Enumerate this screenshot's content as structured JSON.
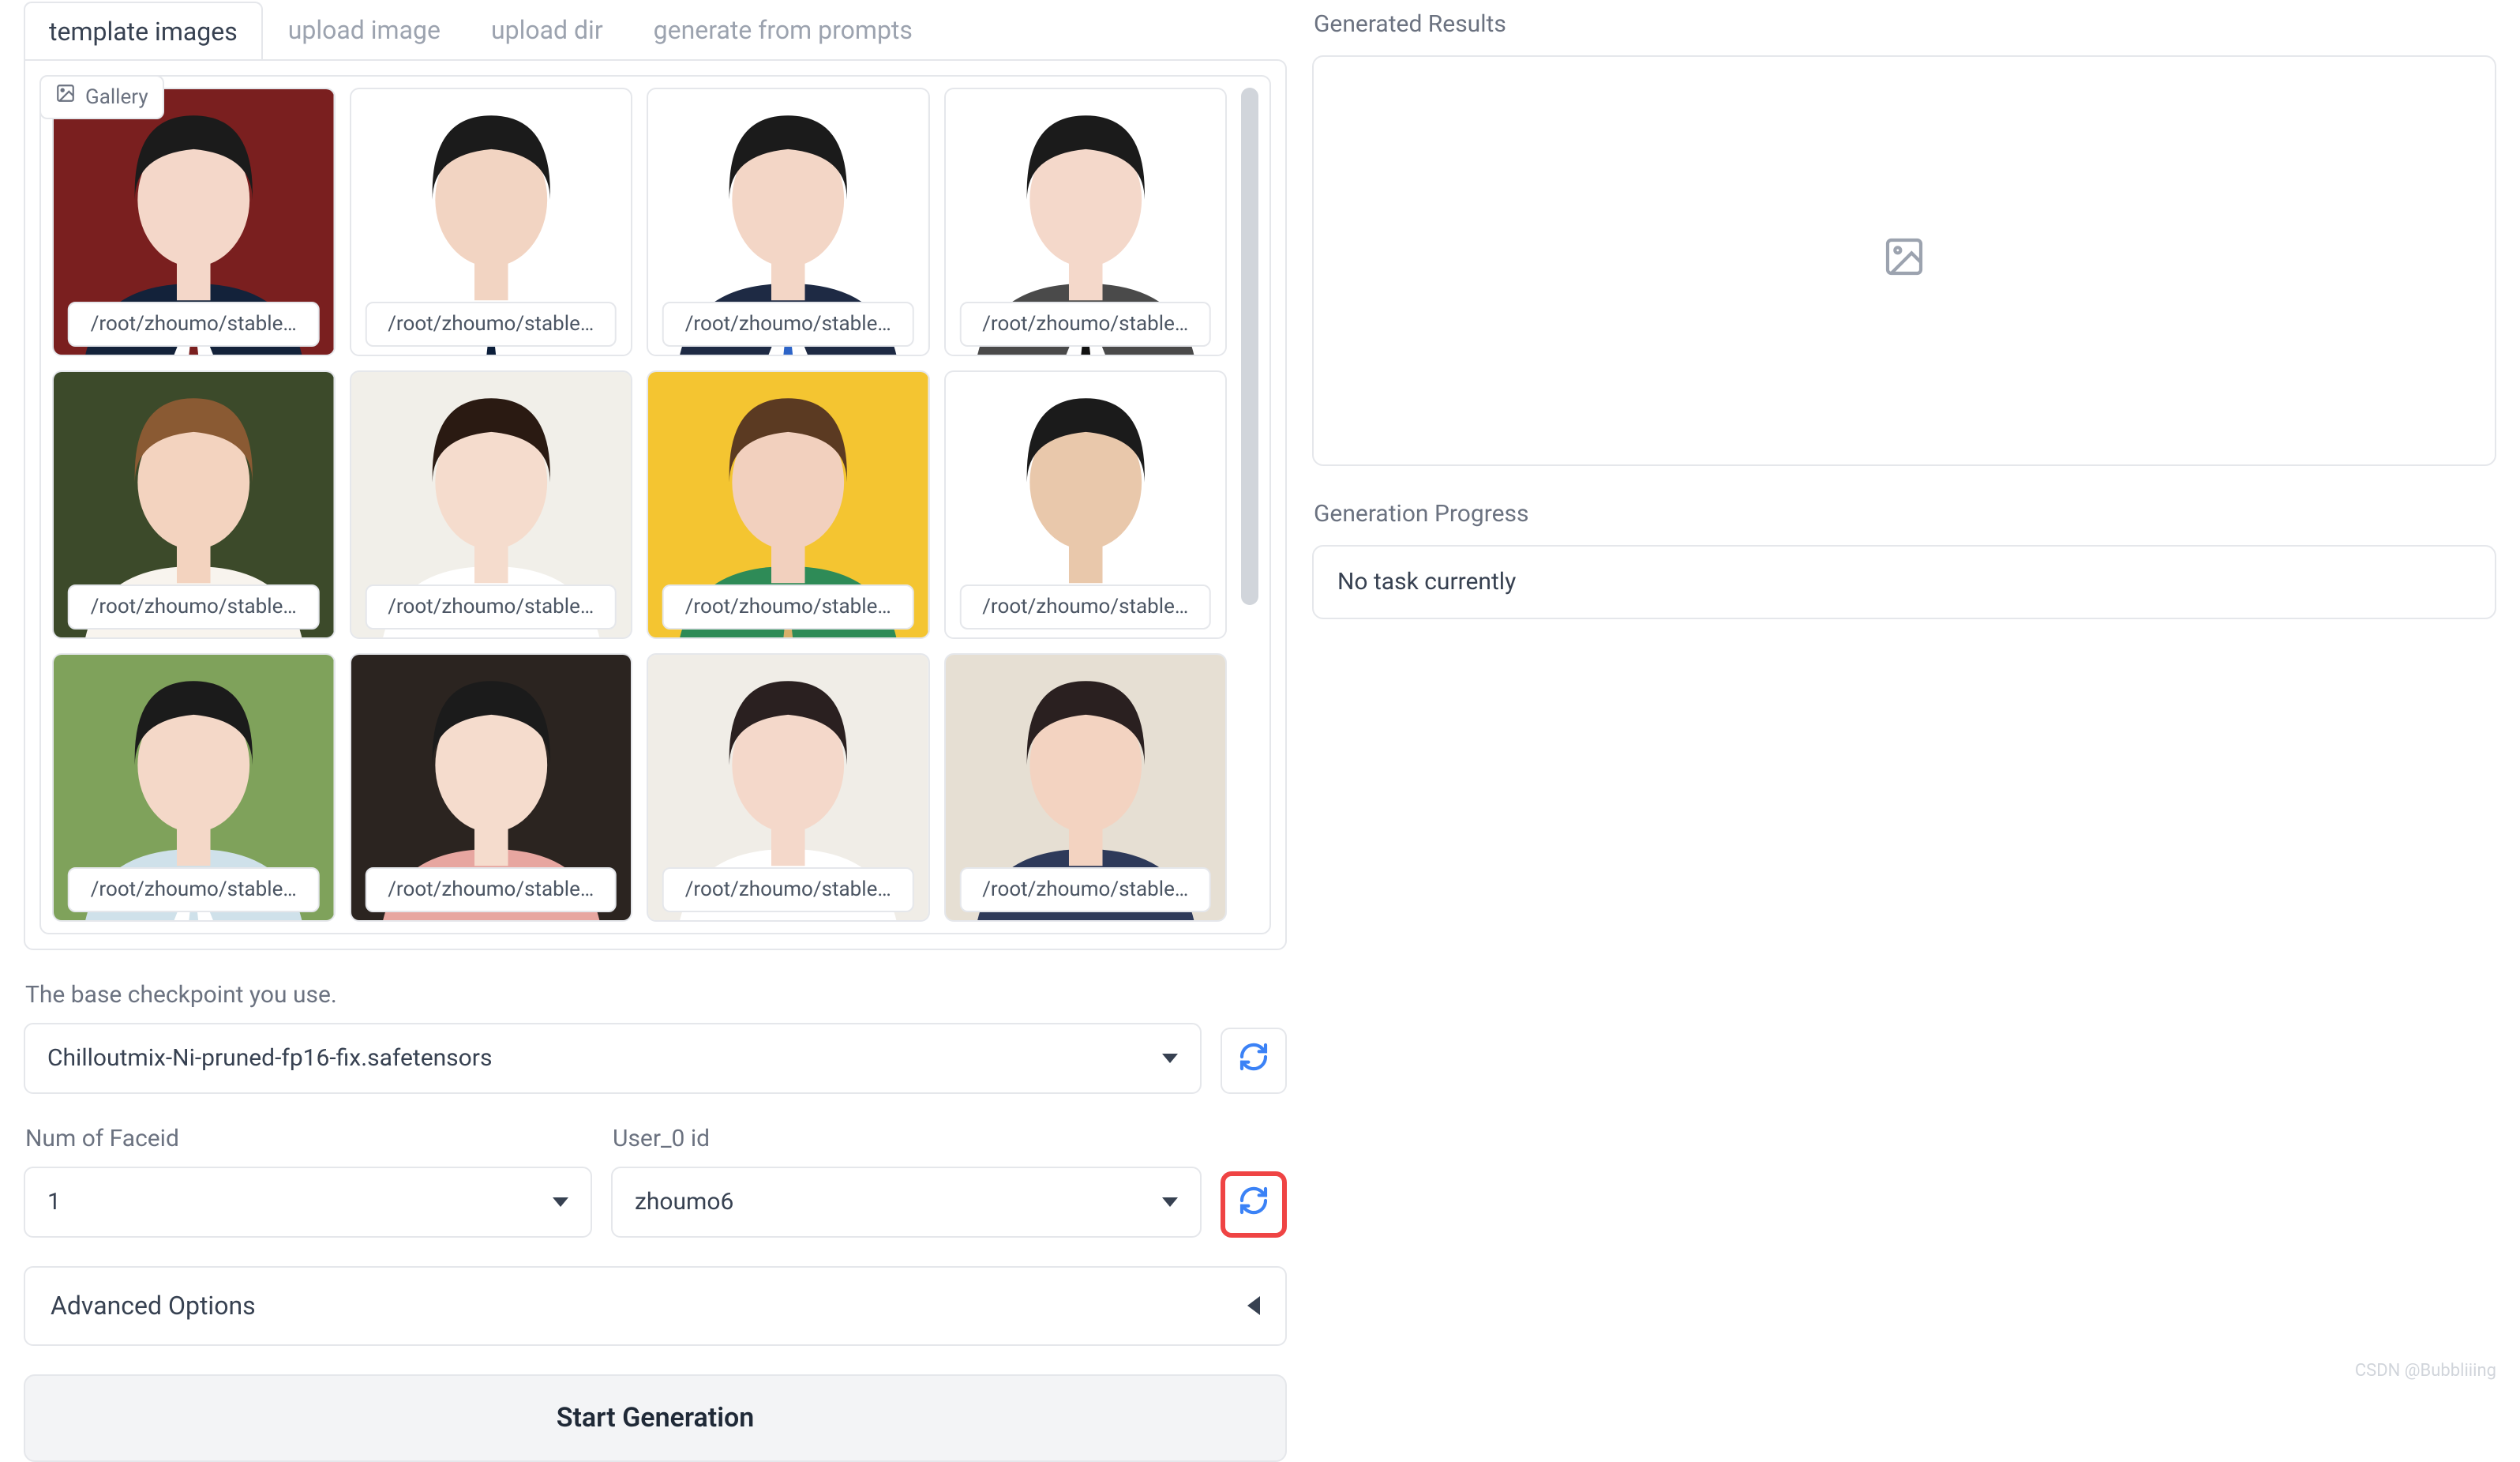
{
  "tabs": [
    {
      "label": "template images",
      "active": true
    },
    {
      "label": "upload image",
      "active": false
    },
    {
      "label": "upload dir",
      "active": false
    },
    {
      "label": "generate from prompts",
      "active": false
    }
  ],
  "gallery": {
    "badge_label": "Gallery",
    "thumbs": [
      {
        "caption": "/root/zhoumo/stable…",
        "bg": "#7a1f1f",
        "skin": "#f4d7c9",
        "hair": "#1b1b1b",
        "shirt": "#ffffff",
        "jacket": "#13223a",
        "tie": "#7a1f1f"
      },
      {
        "caption": "/root/zhoumo/stable…",
        "bg": "#ffffff",
        "skin": "#f2d4c2",
        "hair": "#1b1b1b",
        "shirt": "#ffffff",
        "jacket": "#ffffff",
        "tie": "#0b1e3a"
      },
      {
        "caption": "/root/zhoumo/stable…",
        "bg": "#ffffff",
        "skin": "#f3d6c6",
        "hair": "#1b1b1b",
        "shirt": "#ffffff",
        "jacket": "#1e2a44",
        "tie": "#2d64c7"
      },
      {
        "caption": "/root/zhoumo/stable…",
        "bg": "#ffffff",
        "skin": "#f4d8ca",
        "hair": "#1b1b1b",
        "shirt": "#ffffff",
        "jacket": "#4a4a4a",
        "tie": "#111111"
      },
      {
        "caption": "/root/zhoumo/stable…",
        "bg": "#3c4a2a",
        "skin": "#f3d3bf",
        "hair": "#8a5a33",
        "shirt": "#f8f4ee",
        "jacket": "#f8f4ee",
        "tie": "#f8f4ee"
      },
      {
        "caption": "/root/zhoumo/stable…",
        "bg": "#f1efe9",
        "skin": "#f5dccd",
        "hair": "#2a1a12",
        "shirt": "#ffffff",
        "jacket": "#ffffff",
        "tie": "#ffffff"
      },
      {
        "caption": "/root/zhoumo/stable…",
        "bg": "#f4c531",
        "skin": "#f2d0be",
        "hair": "#5b3a22",
        "shirt": "#2e8b57",
        "jacket": "#2e8b57",
        "tie": "#d8b06a"
      },
      {
        "caption": "/root/zhoumo/stable…",
        "bg": "#ffffff",
        "skin": "#e9c8ab",
        "hair": "#1b1b1b",
        "shirt": "#ffffff",
        "jacket": "#ffffff",
        "tie": "#ffffff"
      },
      {
        "caption": "/root/zhoumo/stable…",
        "bg": "#7fa25b",
        "skin": "#f4d8c8",
        "hair": "#1b1b1b",
        "shirt": "#ffffff",
        "jacket": "#cfe1ea",
        "tie": "#cfe1ea"
      },
      {
        "caption": "/root/zhoumo/stable…",
        "bg": "#2b2420",
        "skin": "#f5dccd",
        "hair": "#1b1b1b",
        "shirt": "#e7a6a0",
        "jacket": "#e7a6a0",
        "tie": "#e7a6a0"
      },
      {
        "caption": "/root/zhoumo/stable…",
        "bg": "#f0ede7",
        "skin": "#f4d8ca",
        "hair": "#2a2020",
        "shirt": "#ffffff",
        "jacket": "#ffffff",
        "tie": "#ffffff"
      },
      {
        "caption": "/root/zhoumo/stable…",
        "bg": "#e6dfd3",
        "skin": "#f3d3c1",
        "hair": "#2a2020",
        "shirt": "#2e3a5a",
        "jacket": "#2e3a5a",
        "tie": "#2e3a5a"
      }
    ]
  },
  "checkpoint": {
    "label": "The base checkpoint you use.",
    "value": "Chilloutmix-Ni-pruned-fp16-fix.safetensors"
  },
  "num_faceid": {
    "label": "Num of Faceid",
    "value": "1"
  },
  "user_id": {
    "label": "User_0 id",
    "value": "zhoumo6"
  },
  "advanced_label": "Advanced Options",
  "start_button": "Start Generation",
  "results": {
    "label": "Generated Results"
  },
  "progress": {
    "label": "Generation Progress",
    "value": "No task currently"
  },
  "watermark": "CSDN @Bubbliiing"
}
